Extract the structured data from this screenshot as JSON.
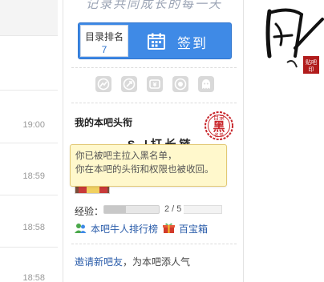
{
  "feed": {
    "times": [
      "19:00",
      "18:59",
      "18:58",
      "18:58"
    ]
  },
  "sidebar": {
    "slogan": "记录共同成长的每一天",
    "signin": {
      "rank_label": "目录排名",
      "rank_value": "7",
      "button_label": "签到",
      "accent": "#3f8ae6"
    },
    "tool_icons": [
      "chart-icon",
      "rocket-icon",
      "coin-icon",
      "medal-icon",
      "ghost-icon"
    ],
    "member_title": {
      "heading": "我的本吧头衔",
      "stamp_top": "目录",
      "stamp_main": "黑",
      "stamp_sub": "名单",
      "user_peek": "S...l 打 长 链"
    },
    "experience": {
      "label": "经验：",
      "value_text": "2 / 5",
      "progress_fraction": 0.4
    },
    "links": {
      "ranking": "本吧牛人排行榜",
      "treasure": "百宝箱"
    },
    "invite": {
      "link": "邀请新吧友",
      "rest": "，为本吧添人气"
    }
  },
  "tooltip": {
    "line1": "你已被吧主拉入黑名单，",
    "line2": "你在本吧的头衔和权限也被收回。"
  },
  "banner": {
    "brush_text": "目录",
    "seal_text": "贴吧"
  }
}
